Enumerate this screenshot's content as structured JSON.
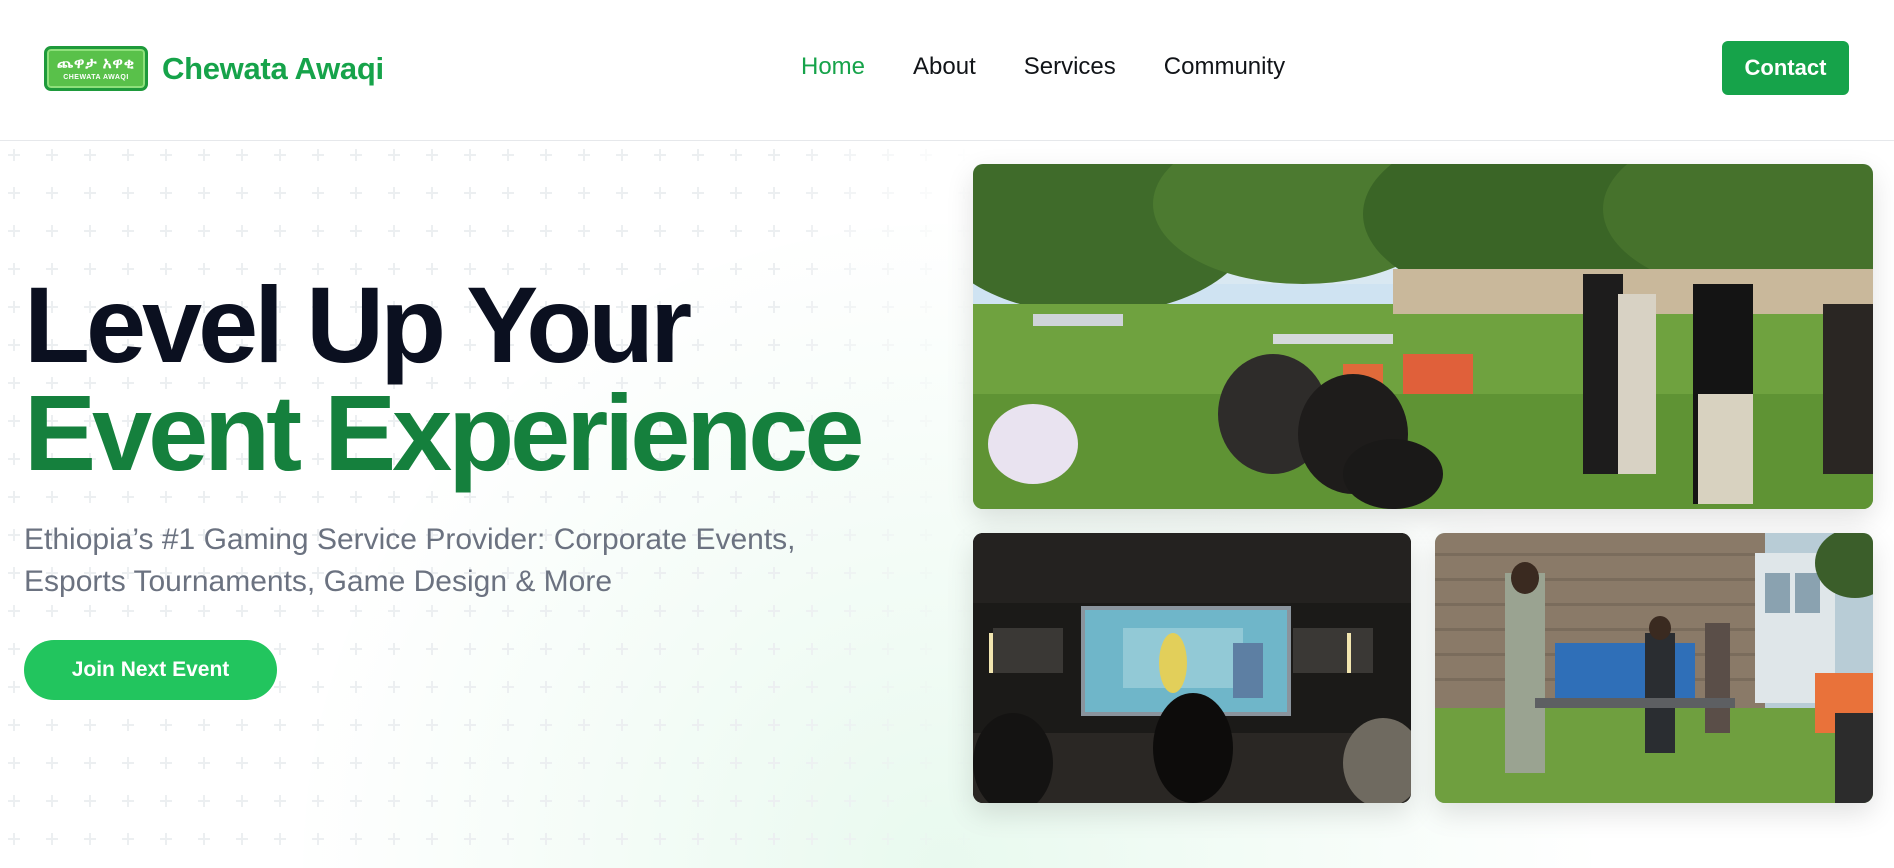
{
  "header": {
    "logo": {
      "amharic_text": "ጨዋታ አዋቂ",
      "latin_text": "CHEWATA AWAQI"
    },
    "brand_name": "Chewata Awaqi",
    "nav": [
      {
        "label": "Home",
        "active": true
      },
      {
        "label": "About",
        "active": false
      },
      {
        "label": "Services",
        "active": false
      },
      {
        "label": "Community",
        "active": false
      }
    ],
    "contact_label": "Contact"
  },
  "hero": {
    "headline_line1": "Level Up Your",
    "headline_line2": "Event Experience",
    "subtitle": "Ethiopia’s #1 Gaming Service Provider: Corporate Events, Esports Tournaments, Game Design & More",
    "cta_label": "Join Next Event"
  },
  "photos": [
    {
      "name": "outdoor-event-photo"
    },
    {
      "name": "screening-event-photo"
    },
    {
      "name": "council-courtyard-photo"
    }
  ],
  "colors": {
    "brand_green": "#16a34a",
    "cta_green": "#22c55e",
    "headline_green": "#15803d",
    "headline_dark": "#0b1020",
    "subtitle_gray": "#6b7280"
  }
}
